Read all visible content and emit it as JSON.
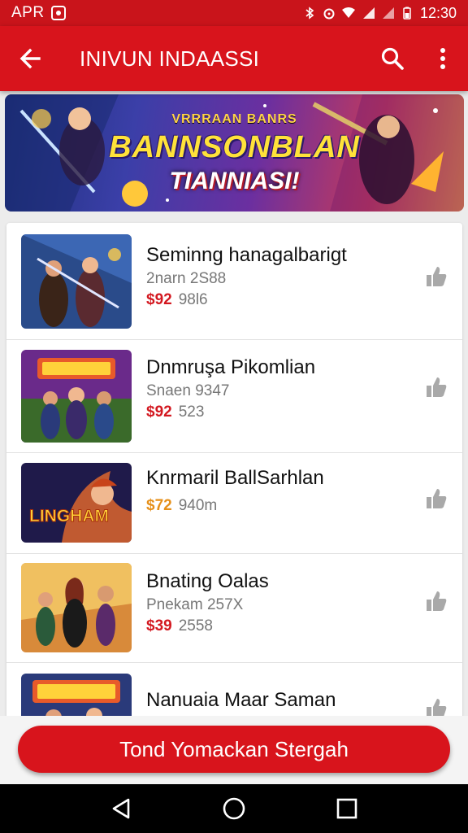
{
  "status_bar": {
    "left_text": "APR",
    "time": "12:30"
  },
  "app_bar": {
    "title": "INIVUN INDAASSI",
    "back_icon": "arrow-back-icon",
    "search_icon": "search-icon",
    "more_icon": "more-vert-icon"
  },
  "banner": {
    "line1": "VRRRAAN BANRS",
    "line2": "BANNSONBLAN",
    "line3": "TIANNIASI!"
  },
  "items": [
    {
      "name": "Seminng hanagalbarigt",
      "sub": "2narn 2S88",
      "price": "$92",
      "extra": "98l6"
    },
    {
      "name": "Dnmruşa Pikomlian",
      "sub": "Snaen 9347",
      "price": "$92",
      "extra": "523"
    },
    {
      "name": "Knrmaril BallSarhlan",
      "sub": "",
      "price": "$72",
      "extra": "940m",
      "thumb_text": "LINGHAM"
    },
    {
      "name": "Bnating Oalas",
      "sub": "Pnekam 257X",
      "price": "$39",
      "extra": "2558"
    },
    {
      "name": "Nanuaia Maar Saman",
      "sub": "",
      "price": "",
      "extra": ""
    }
  ],
  "cta": {
    "label": "Tond Yomackan Stergah"
  },
  "colors": {
    "primary": "#d8141c",
    "price": "#d31820",
    "price_alt": "#e6901a"
  }
}
